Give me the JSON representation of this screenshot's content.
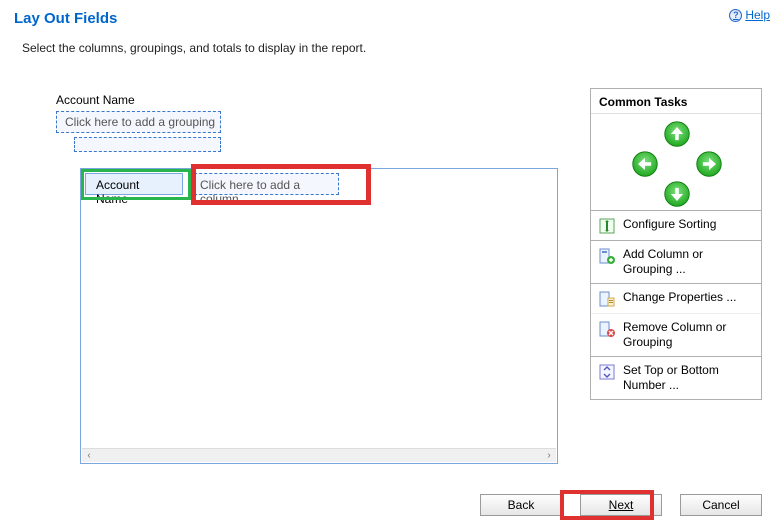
{
  "header": {
    "title": "Lay Out Fields",
    "help_label": "Help"
  },
  "instruction": "Select the columns, groupings, and totals to display in the report.",
  "layout": {
    "group_label": "Account Name",
    "grouping_placeholder": "Click here to add a grouping",
    "column_account": "Account Name",
    "add_column_placeholder": "Click here to add a column"
  },
  "panel": {
    "header": "Common Tasks",
    "links": {
      "sort": "Configure Sorting",
      "add_col": "Add Column or Grouping ...",
      "change_props": "Change Properties ...",
      "remove_col": "Remove Column or Grouping",
      "top_bottom": "Set Top or Bottom Number ..."
    }
  },
  "footer": {
    "back": "Back",
    "next": "Next",
    "cancel": "Cancel"
  }
}
